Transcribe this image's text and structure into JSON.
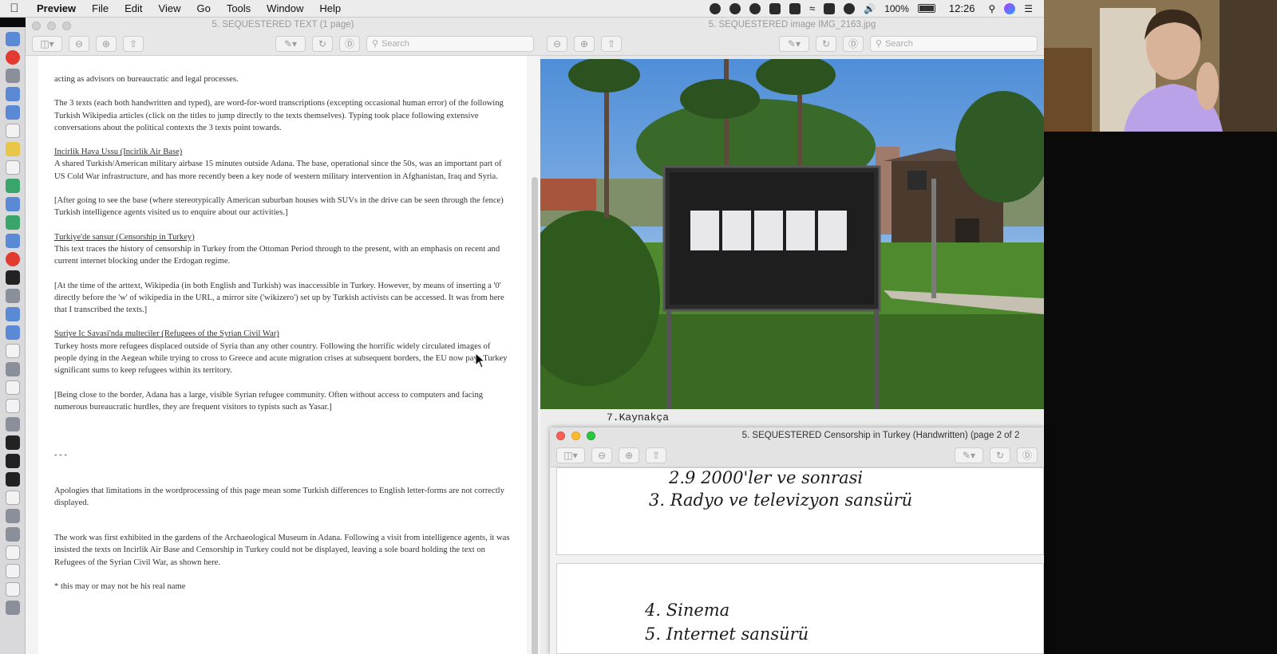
{
  "menubar": {
    "app_name": "Preview",
    "menus": [
      "File",
      "Edit",
      "View",
      "Go",
      "Tools",
      "Window",
      "Help"
    ],
    "battery": "100%",
    "clock": "12:26"
  },
  "text_window": {
    "title": "5. SEQUESTERED TEXT (1 page)",
    "search_placeholder": "Search",
    "paragraphs": {
      "p0": "acting as advisors on bureaucratic and legal processes.",
      "p1": "The 3 texts (each both handwritten and typed), are word-for-word transcriptions (excepting occasional human error) of the following Turkish Wikipedia articles (click on the titles to jump directly to the texts themselves). Typing took place following extensive conversations about the political contexts the 3 texts point towards.",
      "h1": "Incirlik Hava Ussu (Incirlik Air Base)",
      "p2": "A shared Turkish/American military airbase 15 minutes outside Adana. The base, operational since the 50s, was an important part of US Cold War infrastructure, and has more recently been a key node of western military intervention in Afghanistan, Iraq and Syria.",
      "p3": "[After going to see the base (where stereotypically American suburban houses with SUVs in the drive can be seen through the fence) Turkish intelligence agents visited us to enquire about our activities.]",
      "h2": "Turkiye'de sansur (Censorship in Turkey)",
      "p4": "This text traces the history of censorship in Turkey from the Ottoman Period through to the present, with an emphasis on recent and current internet blocking under the Erdogan regime.",
      "p5": "[At the time of the arttext, Wikipedia (in both English and Turkish) was inaccessible in Turkey. However, by means of inserting a '0' directly before the 'w' of wikipedia in the URL, a mirror site ('wikizero') set up by Turkish activists can be accessed. It was from here that I transcribed the texts.]",
      "h3": "Suriye Ic Savasi'nda multeciler (Refugees of the Syrian Civil War)",
      "p6": "Turkey hosts more refugees displaced outside of Syria than any other country. Following the horrific widely circulated images of people dying in the Aegean while trying to cross to Greece and acute migration crises at subsequent borders, the EU now pays Turkey significant sums to keep refugees within its territory.",
      "p7": "[Being close to the border, Adana has a large, visible Syrian refugee community. Often without access to computers and facing numerous bureaucratic hurdles, they are frequent visitors to typists such as Yasar.]",
      "sep": "- - -",
      "p8": "Apologies that limitations in the wordprocessing of this page mean some Turkish differences to English letter-forms are not correctly displayed.",
      "p9": "The work was first exhibited in the gardens of the Archaeological Museum in Adana. Following a visit from intelligence agents, it was insisted the texts on Incirlik Air Base and Censorship in Turkey could not be displayed, leaving a sole board holding the text on Refugees of the Syrian Civil War, as shown here.",
      "p10": "* this may or may not be his real name"
    }
  },
  "image_window": {
    "title": "5. SEQUESTERED image IMG_2163.jpg",
    "search_placeholder": "Search"
  },
  "handwritten_window": {
    "behind_label": "7.Kaynakça",
    "title": "5. SEQUESTERED Censorship in Turkey (Handwritten) (page 2 of 2",
    "lines": {
      "l1": "2.9  2000'ler  ve  sonrasi",
      "l2": "3.  Radyo  ve  televizyon  sansürü",
      "l3": "4.  Sinema",
      "l4": "5.  Internet  sansürü"
    }
  },
  "icons": {
    "apple": "apple-icon",
    "sidebar": "sidebar-icon",
    "zoom_out": "zoom-out-icon",
    "zoom_in": "zoom-in-icon",
    "share": "share-icon",
    "markup": "pencil-icon",
    "rotate": "rotate-icon",
    "annotate": "markup-icon",
    "search": "magnifier-icon"
  },
  "colors": {
    "menubar_bg": "#ececec",
    "traffic_red": "#fc5f57",
    "traffic_yellow": "#fdbc2e",
    "traffic_green": "#28c840",
    "board_black": "#1e1e1e",
    "grass_green": "#4f8a2f",
    "sky_blue": "#6aa0dd"
  }
}
